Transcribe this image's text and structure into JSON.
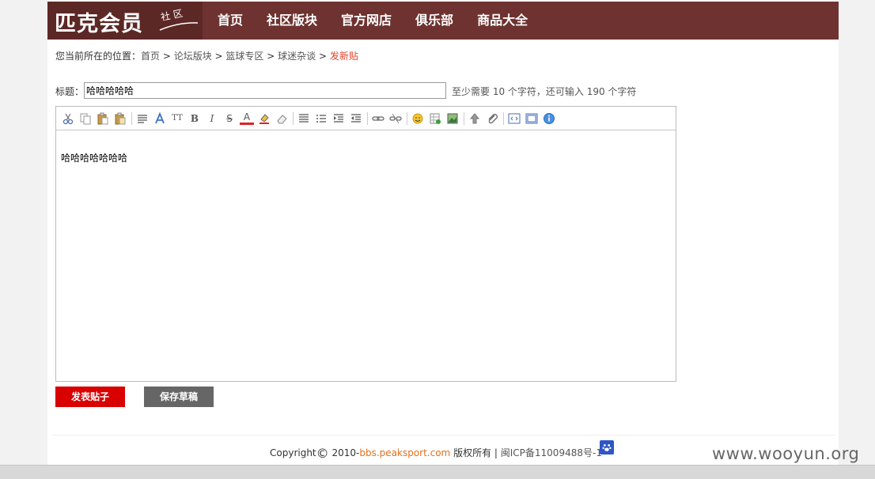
{
  "logo": {
    "main": "匹克会员",
    "sub": "社区"
  },
  "nav": [
    {
      "label": "首页"
    },
    {
      "label": "社区版块"
    },
    {
      "label": "官方网店"
    },
    {
      "label": "俱乐部"
    },
    {
      "label": "商品大全"
    }
  ],
  "breadcrumb": {
    "prefix": "您当前所在的位置：",
    "separator": " > ",
    "items": [
      "首页",
      "论坛版块",
      "篮球专区",
      "球迷杂谈"
    ],
    "current": "发新贴"
  },
  "title_field": {
    "label": "标题：",
    "value": "哈哈哈哈哈",
    "hint": "至少需要 10 个字符，还可输入 190 个字符"
  },
  "editor": {
    "content": "哈哈哈哈哈哈哈",
    "toolbar_icons": [
      "cut-icon",
      "copy-icon",
      "paste-icon",
      "paste-text-icon",
      "font-family-icon",
      "font-style-icon",
      "font-size-icon",
      "bold-icon",
      "italic-icon",
      "strikethrough-icon",
      "font-color-icon",
      "highlight-icon",
      "eraser-icon",
      "align-icon",
      "list-icon",
      "indent-icon",
      "outdent-icon",
      "link-icon",
      "unlink-icon",
      "emoticon-icon",
      "table-icon",
      "image-icon",
      "upload-icon",
      "attachment-icon",
      "source-code-icon",
      "fullscreen-icon",
      "about-icon"
    ],
    "toolbar_glyphs": {
      "font_size": "TT",
      "bold": "B",
      "italic": "I",
      "strike": "S",
      "font_color": "A"
    }
  },
  "buttons": {
    "submit": "发表贴子",
    "draft": "保存草稿"
  },
  "footer": {
    "copyright": "Copyright",
    "symbol": "©",
    "year": "2010-",
    "site": "bbs.peaksport.com",
    "rights": " 版权所有 | ",
    "icp": "闽ICP备11009488号-1"
  },
  "watermark": "www.wooyun.org",
  "colors": {
    "header": "#6e3330",
    "logo_bg": "#5c2826",
    "submit": "#d90000",
    "draft": "#666666",
    "current_crumb": "#e2442f",
    "site_link": "#e07020"
  }
}
